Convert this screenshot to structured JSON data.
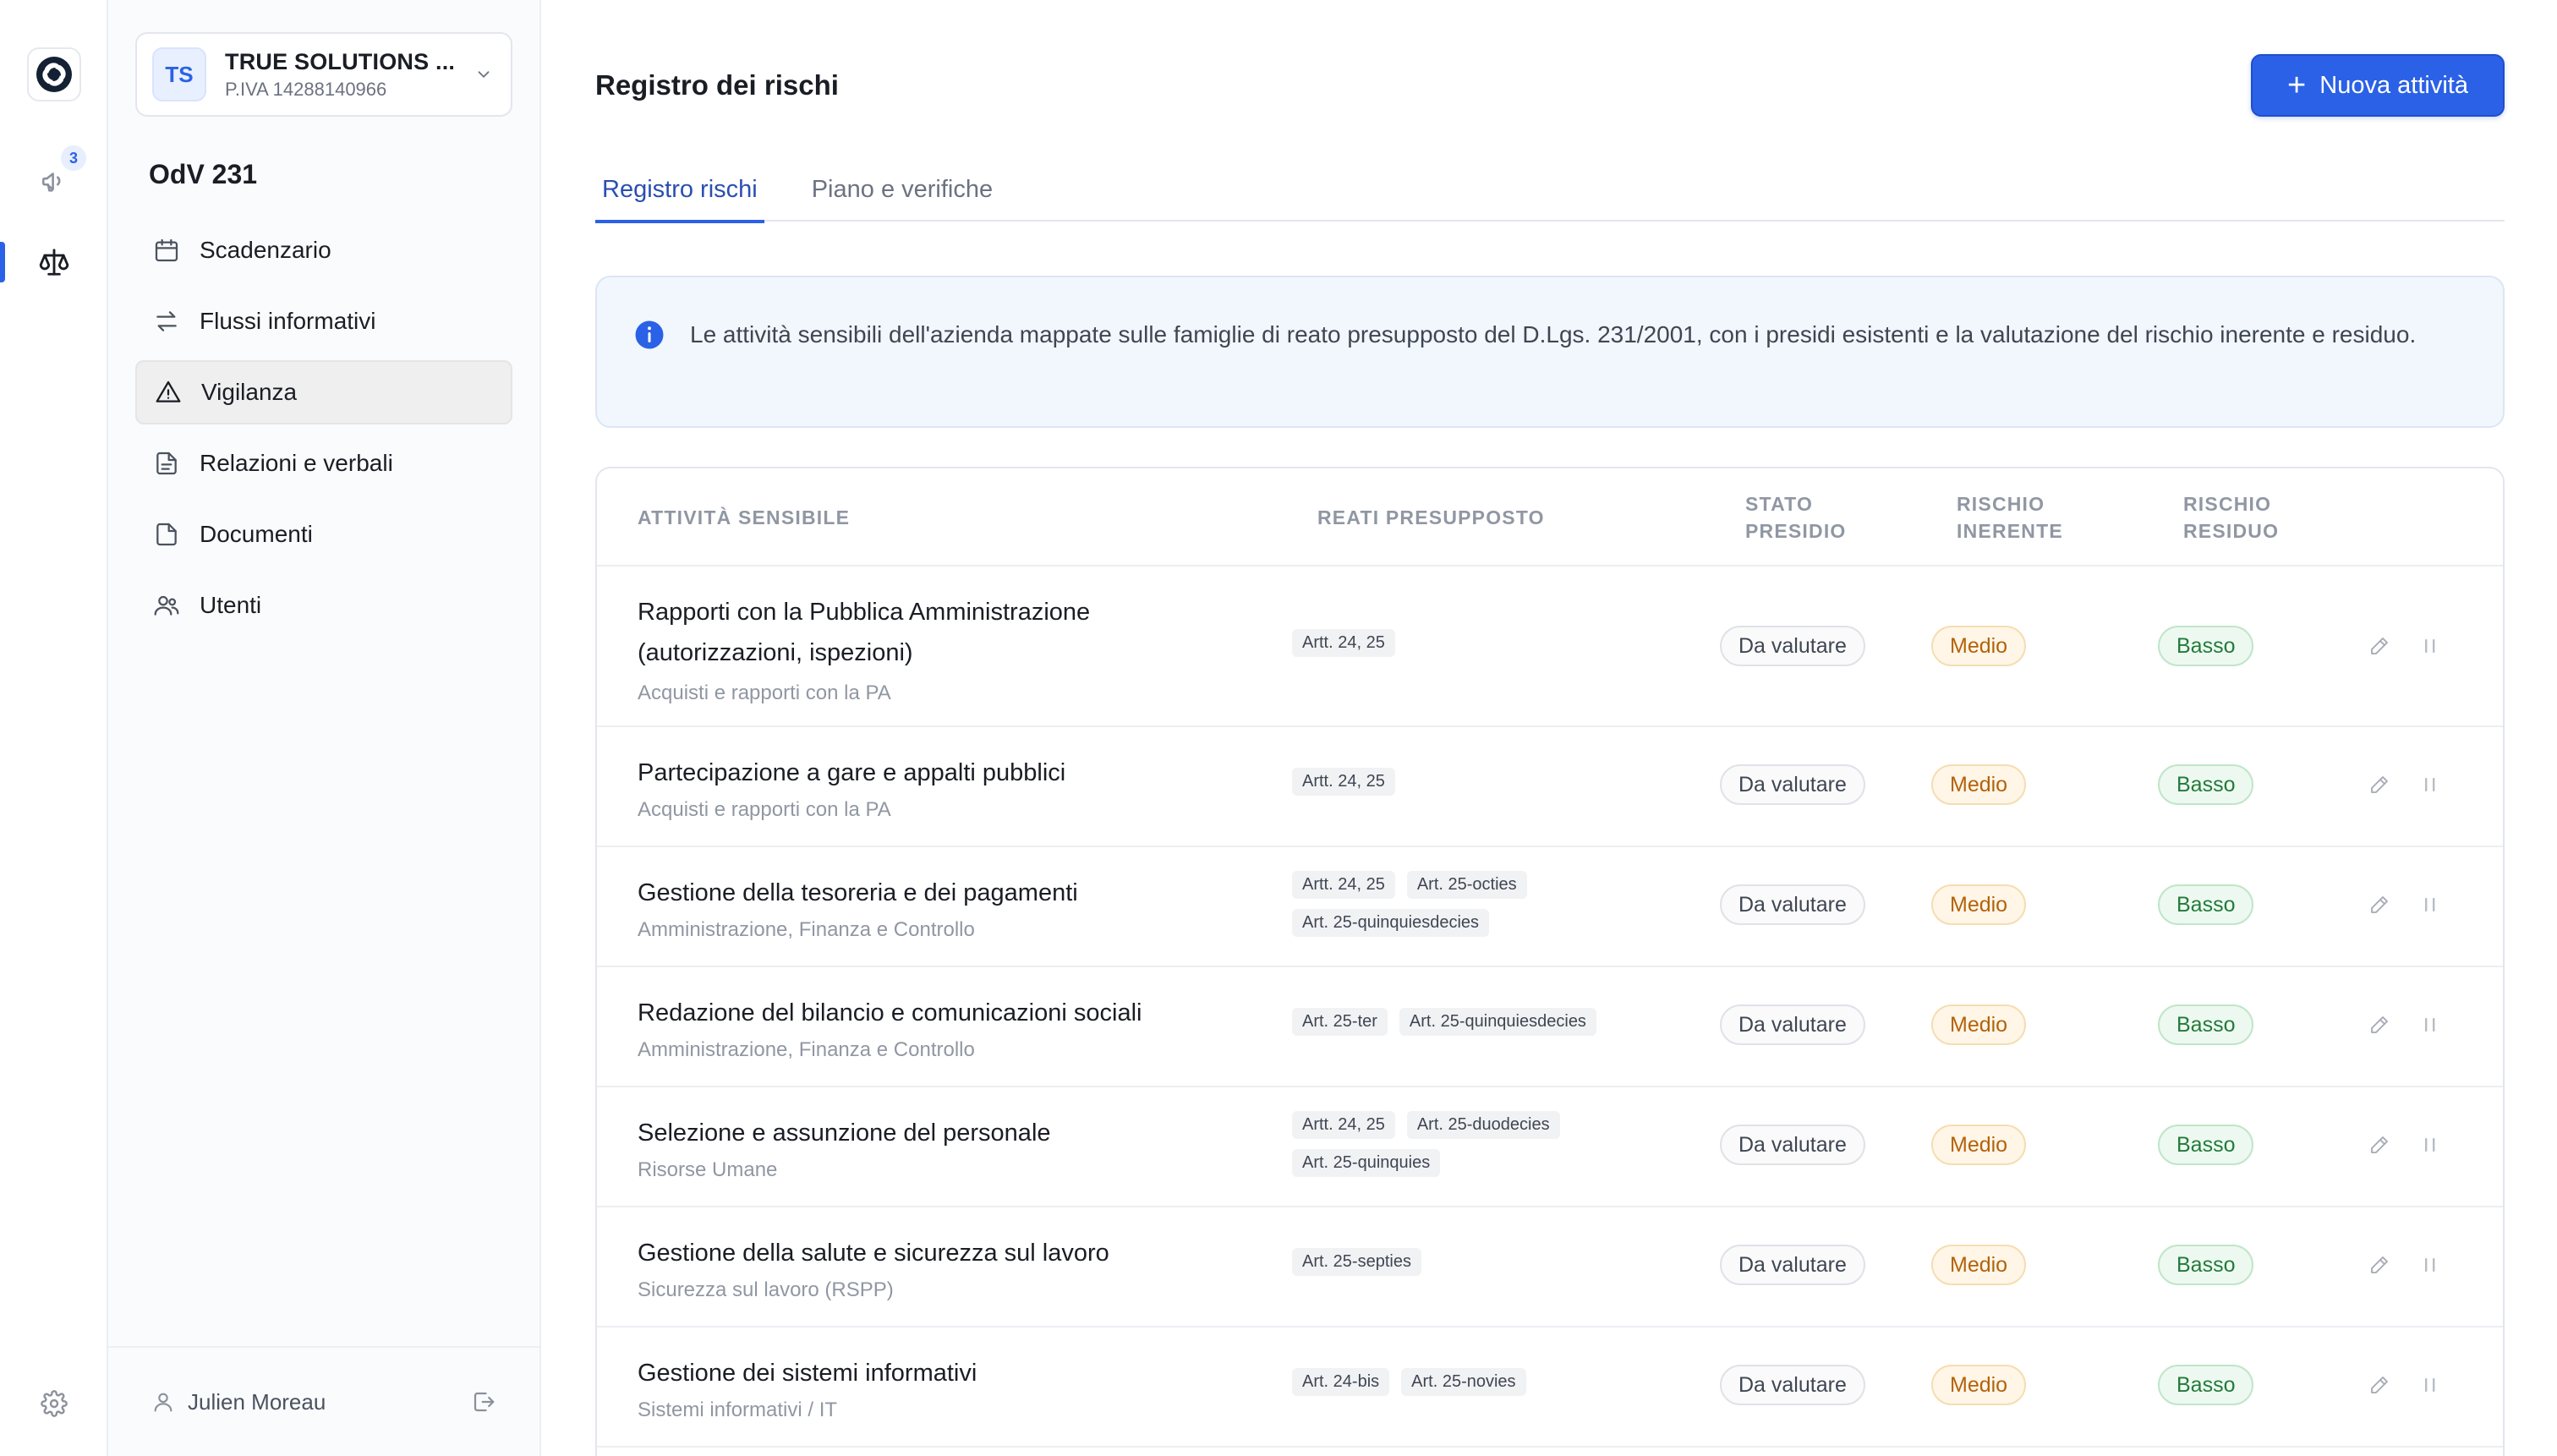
{
  "rail": {
    "notifications_count": "3"
  },
  "company": {
    "initials": "TS",
    "name": "TRUE SOLUTIONS ...",
    "vat": "P.IVA 14288140966"
  },
  "sidebar": {
    "section_title": "OdV 231",
    "items": [
      {
        "label": "Scadenzario",
        "icon": "calendar-icon"
      },
      {
        "label": "Flussi informativi",
        "icon": "arrows-exchange-icon"
      },
      {
        "label": "Vigilanza",
        "icon": "warning-triangle-icon",
        "active": true
      },
      {
        "label": "Relazioni e verbali",
        "icon": "file-text-icon"
      },
      {
        "label": "Documenti",
        "icon": "file-icon"
      },
      {
        "label": "Utenti",
        "icon": "users-icon"
      }
    ],
    "user_name": "Julien Moreau"
  },
  "header": {
    "title": "Registro dei rischi",
    "new_button_label": "Nuova attività"
  },
  "tabs": [
    {
      "label": "Registro rischi",
      "active": true
    },
    {
      "label": "Piano e verifiche",
      "active": false
    }
  ],
  "info": {
    "text": "Le attività sensibili dell'azienda mappate sulle famiglie di reato presupposto del D.Lgs. 231/2001, con i presidi esistenti e la valutazione del rischio inerente e residuo."
  },
  "table": {
    "headers": {
      "activity": "ATTIVITÀ SENSIBILE",
      "reati": "REATI PRESUPPOSTO",
      "stato_1": "STATO",
      "stato_2": "PRESIDIO",
      "inerente_1": "RISCHIO",
      "inerente_2": "INERENTE",
      "residuo_1": "RISCHIO",
      "residuo_2": "RESIDUO"
    },
    "rows": [
      {
        "title": "Rapporti con la Pubblica Amministrazione (autorizzazioni, ispezioni)",
        "subtitle": "Acquisti e rapporti con la PA",
        "reati": [
          "Artt. 24, 25"
        ],
        "stato": "Da valutare",
        "inerente": "Medio",
        "residuo": "Basso"
      },
      {
        "title": "Partecipazione a gare e appalti pubblici",
        "subtitle": "Acquisti e rapporti con la PA",
        "reati": [
          "Artt. 24, 25"
        ],
        "stato": "Da valutare",
        "inerente": "Medio",
        "residuo": "Basso"
      },
      {
        "title": "Gestione della tesoreria e dei pagamenti",
        "subtitle": "Amministrazione, Finanza e Controllo",
        "reati": [
          "Artt. 24, 25",
          "Art. 25-octies",
          "Art. 25-quinquiesdecies"
        ],
        "stato": "Da valutare",
        "inerente": "Medio",
        "residuo": "Basso"
      },
      {
        "title": "Redazione del bilancio e comunicazioni sociali",
        "subtitle": "Amministrazione, Finanza e Controllo",
        "reati": [
          "Art. 25-ter",
          "Art. 25-quinquiesdecies"
        ],
        "stato": "Da valutare",
        "inerente": "Medio",
        "residuo": "Basso"
      },
      {
        "title": "Selezione e assunzione del personale",
        "subtitle": "Risorse Umane",
        "reati": [
          "Artt. 24, 25",
          "Art. 25-duodecies",
          "Art. 25-quinquies"
        ],
        "stato": "Da valutare",
        "inerente": "Medio",
        "residuo": "Basso"
      },
      {
        "title": "Gestione della salute e sicurezza sul lavoro",
        "subtitle": "Sicurezza sul lavoro (RSPP)",
        "reati": [
          "Art. 25-septies"
        ],
        "stato": "Da valutare",
        "inerente": "Medio",
        "residuo": "Basso"
      },
      {
        "title": "Gestione dei sistemi informativi",
        "subtitle": "Sistemi informativi / IT",
        "reati": [
          "Art. 24-bis",
          "Art. 25-novies"
        ],
        "stato": "Da valutare",
        "inerente": "Medio",
        "residuo": "Basso"
      }
    ]
  },
  "colors": {
    "accent": "#2b61e6",
    "medio_bg": "#fff6e8",
    "medio_text": "#b4620a",
    "basso_bg": "#edf9f0",
    "basso_text": "#237a3a"
  }
}
